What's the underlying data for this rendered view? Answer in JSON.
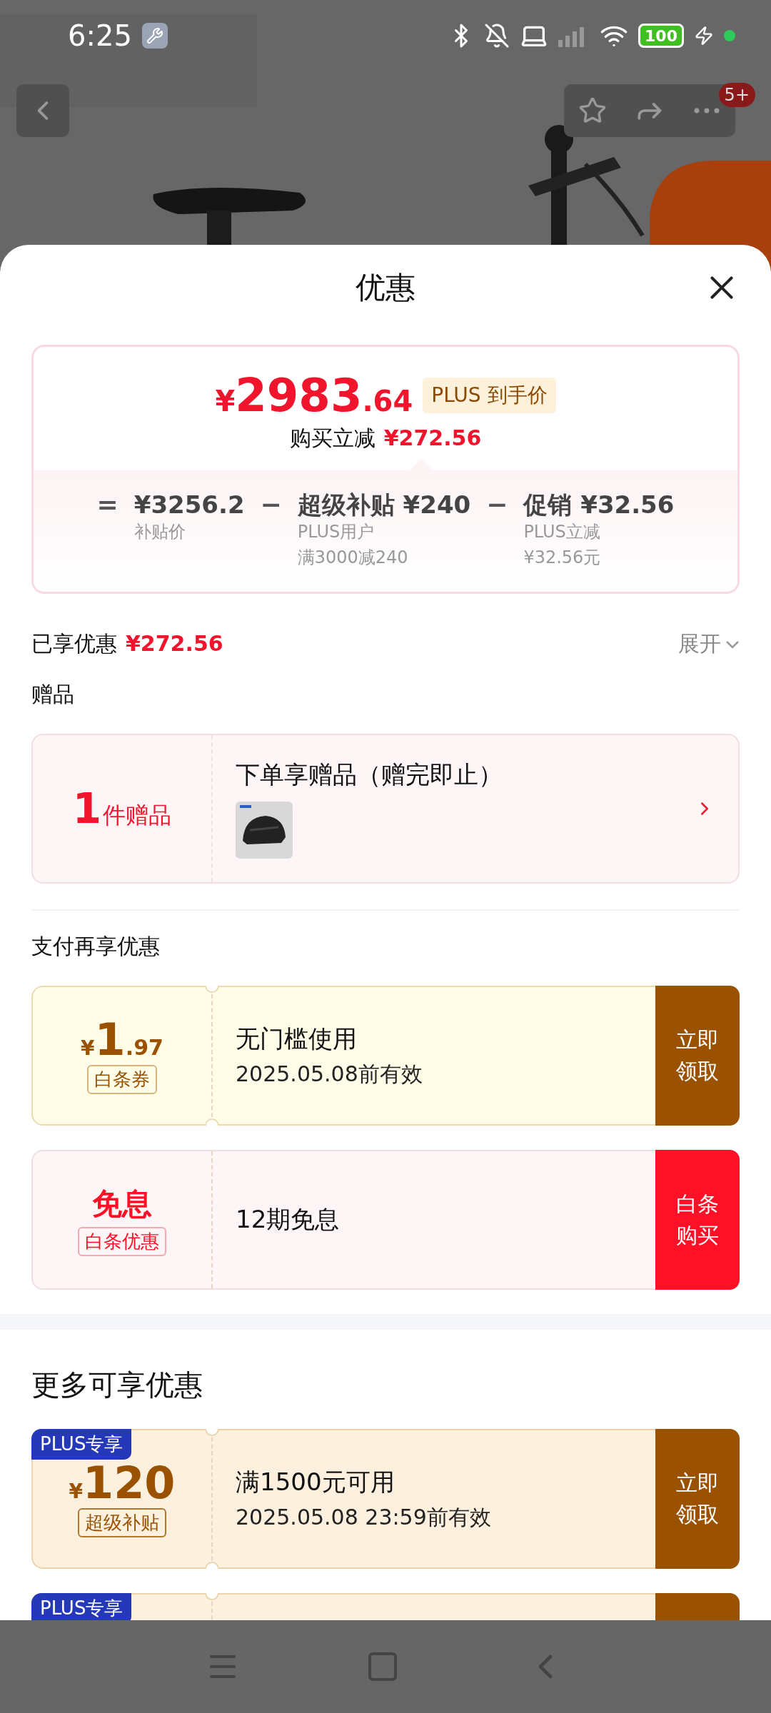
{
  "status_bar": {
    "time": "6:25",
    "battery": "100"
  },
  "top_bar": {
    "badge": "5+"
  },
  "sheet": {
    "title": "优惠"
  },
  "price_card": {
    "currency": "¥",
    "price_int": "2983",
    "price_dec": ".64",
    "price_tag": "PLUS 到手价",
    "saving_label": "购买立减",
    "saving_value": "¥272.56",
    "breakdown": [
      {
        "op": "=",
        "value": "¥3256.2",
        "notes": [
          "补贴价"
        ]
      },
      {
        "op": "−",
        "value": "超级补贴 ¥240",
        "notes": [
          "PLUS用户",
          "满3000减240"
        ]
      },
      {
        "op": "−",
        "value": "促销 ¥32.56",
        "notes": [
          "PLUS立减",
          "¥32.56元"
        ]
      }
    ]
  },
  "enjoyed": {
    "label": "已享优惠",
    "value": "¥272.56",
    "toggle": "展开",
    "expanded": false
  },
  "gifts": {
    "heading": "赠品",
    "count": "1",
    "count_unit": "件赠品",
    "title": "下单享赠品（赠完即止）"
  },
  "pay_section": {
    "heading": "支付再享优惠",
    "offers": [
      {
        "kind": "coupon",
        "color": "#9a5200",
        "currency": "¥",
        "amount": "1",
        "decimal": ".97",
        "tag": "白条券",
        "title": "无门槛使用",
        "subtitle": "2025.05.08前有效",
        "action": "立即领取"
      },
      {
        "kind": "text",
        "color": "#ff1027",
        "headline": "免息",
        "tag": "白条优惠",
        "title": "12期免息",
        "action": "白条购买"
      }
    ]
  },
  "more_section": {
    "heading": "更多可享优惠",
    "offers": [
      {
        "kind": "coupon",
        "color": "#9a5200",
        "badge": "PLUS专享",
        "currency": "¥",
        "amount": "120",
        "tag": "超级补贴",
        "title": "满1500元可用",
        "subtitle": "2025.05.08 23:59前有效",
        "action": "立即领取"
      },
      {
        "kind": "coupon",
        "color": "#9a5200",
        "badge": "PLUS专享"
      }
    ]
  }
}
